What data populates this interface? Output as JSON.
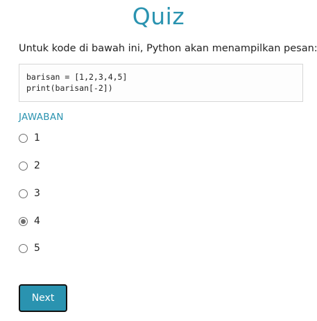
{
  "header": {
    "title": "Quiz"
  },
  "question": {
    "text": "Untuk kode di bawah ini, Python akan menampilkan pesan:",
    "code_lines": [
      "barisan = [1,2,3,4,5]",
      "print(barisan[-2])"
    ]
  },
  "answer": {
    "label": "JAWABAN",
    "options": [
      {
        "label": "1",
        "checked": false
      },
      {
        "label": "2",
        "checked": false
      },
      {
        "label": "3",
        "checked": false
      },
      {
        "label": "4",
        "checked": true
      },
      {
        "label": "5",
        "checked": false
      }
    ]
  },
  "actions": {
    "next_label": "Next"
  },
  "colors": {
    "accent": "#2a93b0",
    "text": "#222222",
    "button_border": "#111111"
  }
}
